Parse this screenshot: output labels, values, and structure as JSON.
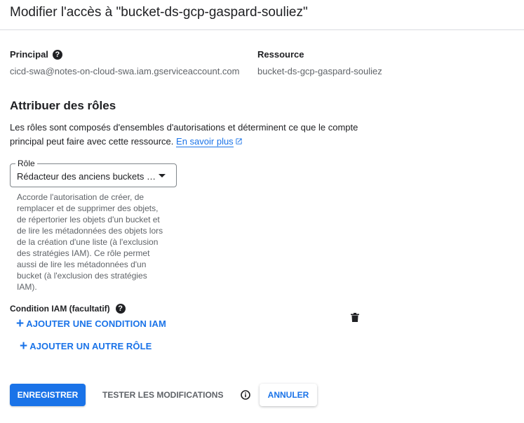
{
  "dialog": {
    "title": "Modifier l'accès à \"bucket-ds-gcp-gaspard-souliez\""
  },
  "principal": {
    "label": "Principal",
    "value": "cicd-swa@notes-on-cloud-swa.iam.gserviceaccount.com"
  },
  "resource": {
    "label": "Ressource",
    "value": "bucket-ds-gcp-gaspard-souliez"
  },
  "roles_section": {
    "title": "Attribuer des rôles",
    "description": "Les rôles sont composés d'ensembles d'autorisations et déterminent ce que le compte principal peut faire avec cette ressource.",
    "learn_more": "En savoir plus"
  },
  "role": {
    "label": "Rôle",
    "selected": "Rédacteur des anciens buckets de Storage",
    "description": "Accorde l'autorisation de créer, de remplacer et de supprimer des objets, de répertorier les objets d'un bucket et de lire les métadonnées des objets lors de la création d'une liste (à l'exclusion des stratégies IAM). Ce rôle permet aussi de lire les métadonnées d'un bucket (à l'exclusion des stratégies IAM)."
  },
  "condition": {
    "label": "Condition IAM (facultatif)",
    "add_label": "AJOUTER UNE CONDITION IAM"
  },
  "add_role_label": "AJOUTER UN AUTRE RÔLE",
  "actions": {
    "save": "ENREGISTRER",
    "test": "TESTER LES MODIFICATIONS",
    "cancel": "ANNULER"
  },
  "colors": {
    "accent": "#1a73e8",
    "text": "#202124",
    "muted": "#5f6368"
  },
  "icons": [
    "help-icon",
    "external-link-icon",
    "dropdown-caret-icon",
    "plus-icon",
    "trash-icon",
    "info-icon"
  ]
}
